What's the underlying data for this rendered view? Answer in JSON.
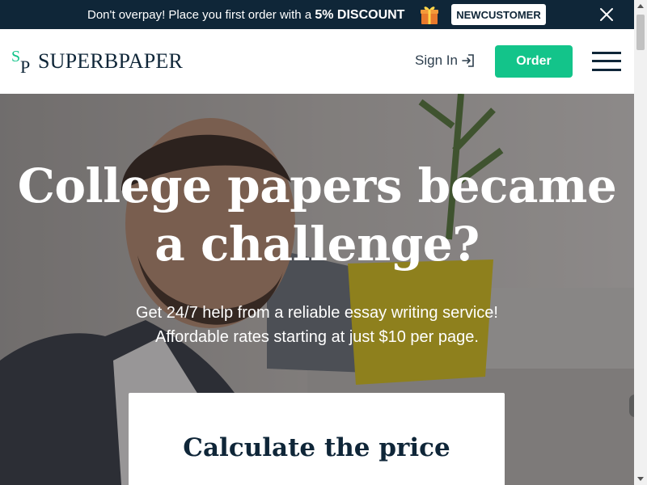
{
  "promo": {
    "text": "Don't overpay! Place you first order with a ",
    "discount": "5% DISCOUNT",
    "code": "NEWCUSTOMER"
  },
  "header": {
    "logo_text": "SUPERBPAPER",
    "logo_mark_s": "S",
    "logo_mark_p": "P",
    "signin_label": "Sign In",
    "order_label": "Order"
  },
  "hero": {
    "title_line1": "College papers became",
    "title_line2": "a challenge?",
    "subtitle_line1": "Get 24/7 help from a reliable essay writing service!",
    "subtitle_line2": "Affordable rates starting at just $10 per page."
  },
  "calculator": {
    "title": "Calculate the price"
  },
  "colors": {
    "promo_bg": "#0f2638",
    "accent": "#13c48a",
    "navy": "#0f2638"
  }
}
